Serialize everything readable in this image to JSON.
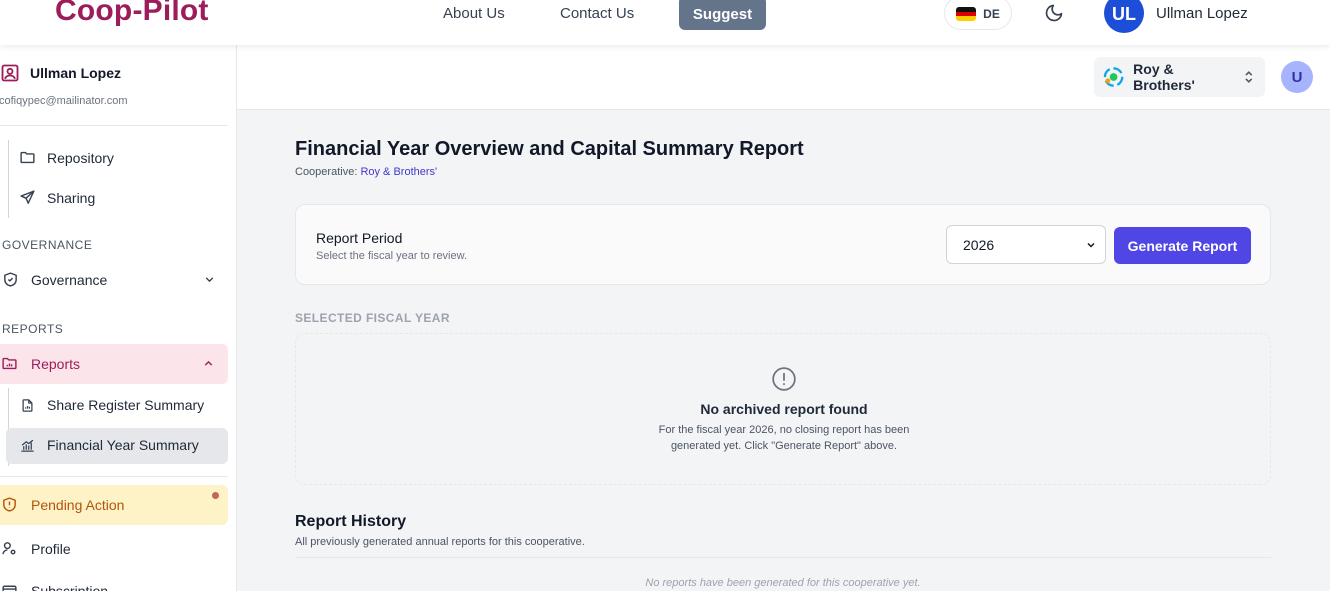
{
  "brand": "Coop-Pilot",
  "nav": {
    "about": "About Us",
    "contact": "Contact Us",
    "suggest": "Suggest",
    "language": "DE",
    "user_initials": "UL",
    "user_name": "Ullman Lopez"
  },
  "sidebar": {
    "user_name": "Ullman Lopez",
    "user_email": "cofiqypec@mailinator.com",
    "items_top": [
      {
        "label": "Repository",
        "icon": "folder-icon"
      },
      {
        "label": "Sharing",
        "icon": "send-icon"
      }
    ],
    "section_governance": "GOVERNANCE",
    "governance": "Governance",
    "section_reports": "REPORTS",
    "reports": "Reports",
    "report_items": [
      {
        "label": "Share Register Summary",
        "icon": "file-chart-icon"
      },
      {
        "label": "Financial Year Summary",
        "icon": "chart-icon",
        "active": true
      }
    ],
    "pending": "Pending Action",
    "profile": "Profile",
    "subscription": "Subscription"
  },
  "header": {
    "cooperative": "Roy & Brothers'",
    "avatar": "U"
  },
  "page": {
    "title": "Financial Year Overview and Capital Summary Report",
    "coop_prefix": "Cooperative:",
    "coop_name": "Roy & Brothers'"
  },
  "period": {
    "label": "Report Period",
    "description": "Select the fiscal year to review.",
    "selected_year": "2026",
    "generate_label": "Generate Report"
  },
  "fiscal": {
    "section_label": "SELECTED FISCAL YEAR",
    "empty_title": "No archived report found",
    "empty_desc": "For the fiscal year 2026, no closing report has been generated yet. Click \"Generate Report\" above."
  },
  "history": {
    "title": "Report History",
    "description": "All previously generated annual reports for this cooperative.",
    "empty": "No reports have been generated for this cooperative yet."
  },
  "colors": {
    "brand": "#9d1d5a",
    "primary": "#4f46e5",
    "reports_active_bg": "#fbe4ea",
    "pending_bg": "#fef3c7"
  }
}
